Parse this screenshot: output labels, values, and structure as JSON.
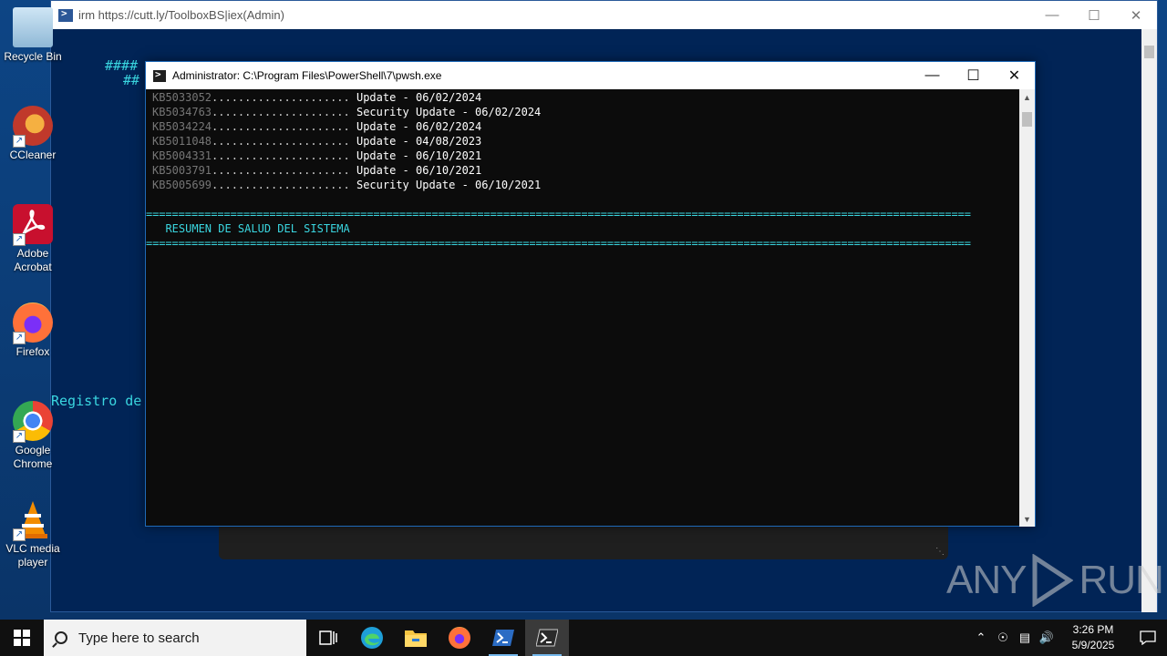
{
  "desktop": {
    "icons": [
      {
        "label": "Recycle Bin",
        "icon": "recycle-bin-icon"
      },
      {
        "label": "CCleaner",
        "icon": "ccleaner-icon"
      },
      {
        "label": "Adobe Acrobat",
        "icon": "adobe-acrobat-icon"
      },
      {
        "label": "Firefox",
        "icon": "firefox-icon"
      },
      {
        "label": "Google Chrome",
        "icon": "chrome-icon"
      },
      {
        "label": "VLC media player",
        "icon": "vlc-icon"
      }
    ]
  },
  "back_window": {
    "title": "irm https://cutt.ly/ToolboxBS|iex(Admin)",
    "text_line_1": "####",
    "text_line_2": "##",
    "text_line_3": "Registro de"
  },
  "front_window": {
    "title": "Administrator: C:\\Program Files\\PowerShell\\7\\pwsh.exe",
    "updates": [
      {
        "kb": "KB5033052",
        "dots": ".....................",
        "desc": " Update - 06/02/2024"
      },
      {
        "kb": "KB5034763",
        "dots": ".....................",
        "desc": " Security Update - 06/02/2024"
      },
      {
        "kb": "KB5034224",
        "dots": ".....................",
        "desc": " Update - 06/02/2024"
      },
      {
        "kb": "KB5011048",
        "dots": ".....................",
        "desc": " Update - 04/08/2023"
      },
      {
        "kb": "KB5004331",
        "dots": ".....................",
        "desc": " Update - 06/10/2021"
      },
      {
        "kb": "KB5003791",
        "dots": ".....................",
        "desc": " Update - 06/10/2021"
      },
      {
        "kb": "KB5005699",
        "dots": ".....................",
        "desc": " Security Update - 06/10/2021"
      }
    ],
    "separator": "===============================================================================================================================",
    "heading": "  RESUMEN DE SALUD DEL SISTEMA"
  },
  "watermark": {
    "left": "ANY",
    "right": "RUN"
  },
  "taskbar": {
    "search_placeholder": "Type here to search",
    "time": "3:26 PM",
    "date": "5/9/2025"
  },
  "colors": {
    "console_cyan": "#3ad6e0",
    "desktop_blue": "#0d4585",
    "ps_background": "#012456"
  }
}
